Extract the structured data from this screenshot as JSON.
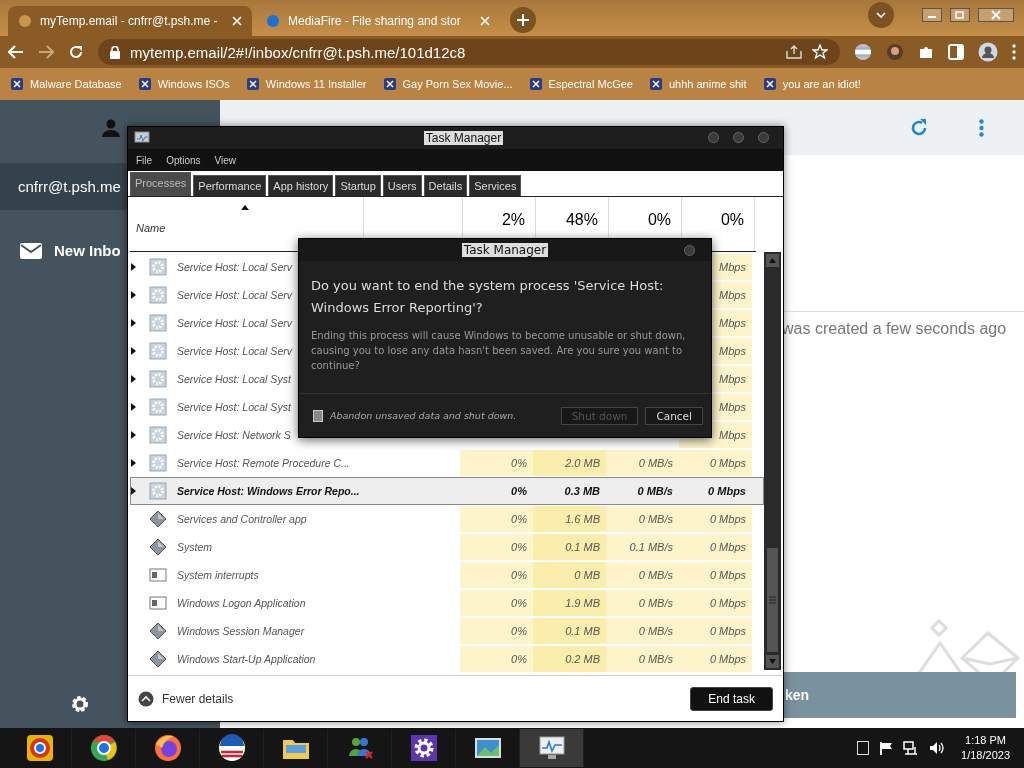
{
  "browser": {
    "tabs": [
      {
        "title": "myTemp.email - cnfrr@t.psh.me -",
        "selected": true
      },
      {
        "title": "MediaFire - File sharing and stor",
        "selected": false
      }
    ],
    "address": "mytemp.email/2#!/inbox/cnfrr@t.psh.me/101d12c8",
    "bookmarks": [
      "Malware Database",
      "Windows ISOs",
      "Windows 11 Installer",
      "Gay Porn Sex Movie...",
      "Espectral McGee",
      "uhhh anime shit",
      "you are an idiot!"
    ]
  },
  "page": {
    "account": "cnfrr@t.psh.me",
    "nav_item": "New Inbo",
    "notice": "was created a few seconds ago",
    "toast": "ken"
  },
  "task_manager": {
    "title": "Task Manager",
    "menu": [
      "File",
      "Options",
      "View"
    ],
    "tabs": [
      {
        "label": "Processes",
        "selected": true
      },
      {
        "label": "Performance",
        "selected": false
      },
      {
        "label": "App history",
        "selected": false
      },
      {
        "label": "Startup",
        "selected": false
      },
      {
        "label": "Users",
        "selected": false
      },
      {
        "label": "Details",
        "selected": false
      },
      {
        "label": "Services",
        "selected": false
      }
    ],
    "name_column": "Name",
    "totals": [
      "2%",
      "48%",
      "0%",
      "0%"
    ],
    "rows": [
      {
        "name": "Service Host: Local Serv",
        "kind": "gear",
        "expandable": true,
        "selected": false,
        "network": "Mbps"
      },
      {
        "name": "Service Host: Local Serv",
        "kind": "gear",
        "expandable": true,
        "selected": false,
        "network": "Mbps"
      },
      {
        "name": "Service Host: Local Serv",
        "kind": "gear",
        "expandable": true,
        "selected": false,
        "network": "Mbps"
      },
      {
        "name": "Service Host: Local Serv",
        "kind": "gear",
        "expandable": true,
        "selected": false,
        "network": "Mbps"
      },
      {
        "name": "Service Host: Local Syst",
        "kind": "gear",
        "expandable": true,
        "selected": false,
        "network": "Mbps"
      },
      {
        "name": "Service Host: Local Syst",
        "kind": "gear",
        "expandable": true,
        "selected": false,
        "network": "Mbps"
      },
      {
        "name": "Service Host: Network S",
        "kind": "gear",
        "expandable": true,
        "selected": false,
        "network": "Mbps"
      },
      {
        "name": "Service Host: Remote Procedure C...",
        "kind": "gear",
        "expandable": true,
        "selected": false,
        "cpu": "0%",
        "memory": "2.0 MB",
        "disk": "0 MB/s",
        "network": "0 Mbps"
      },
      {
        "name": "Service Host: Windows Error Repo...",
        "kind": "gear",
        "expandable": true,
        "selected": true,
        "cpu": "0%",
        "memory": "0.3 MB",
        "disk": "0 MB/s",
        "network": "0 Mbps"
      },
      {
        "name": "Services and Controller app",
        "kind": "diamond",
        "expandable": false,
        "selected": false,
        "cpu": "0%",
        "memory": "1.6 MB",
        "disk": "0 MB/s",
        "network": "0 Mbps"
      },
      {
        "name": "System",
        "kind": "diamond",
        "expandable": false,
        "selected": false,
        "cpu": "0%",
        "memory": "0.1 MB",
        "disk": "0.1 MB/s",
        "network": "0 Mbps"
      },
      {
        "name": "System interrupts",
        "kind": "window",
        "expandable": false,
        "selected": false,
        "cpu": "0%",
        "memory": "0 MB",
        "disk": "0 MB/s",
        "network": "0 Mbps"
      },
      {
        "name": "Windows Logon Application",
        "kind": "window",
        "expandable": false,
        "selected": false,
        "cpu": "0%",
        "memory": "1.9 MB",
        "disk": "0 MB/s",
        "network": "0 Mbps"
      },
      {
        "name": "Windows Session Manager",
        "kind": "diamond",
        "expandable": false,
        "selected": false,
        "cpu": "0%",
        "memory": "0.1 MB",
        "disk": "0 MB/s",
        "network": "0 Mbps"
      },
      {
        "name": "Windows Start-Up Application",
        "kind": "diamond",
        "expandable": false,
        "selected": false,
        "cpu": "0%",
        "memory": "0.2 MB",
        "disk": "0 MB/s",
        "network": "0 Mbps"
      }
    ],
    "fewer_details": "Fewer details",
    "end_task": "End task"
  },
  "dialog": {
    "title": "Task Manager",
    "heading": "Do you want to end the system process 'Service Host: Windows Error Reporting'?",
    "body": "Ending this process will cause Windows to become unusable or shut down, causing you to lose any data hasn't been saved. Are you sure you want to continue?",
    "checkbox": {
      "label": "Abandon unsaved data and shut down.",
      "checked": false
    },
    "buttons": [
      {
        "label": "Shut down",
        "disabled": true
      },
      {
        "label": "Cancel",
        "disabled": false
      }
    ]
  },
  "taskbar": {
    "apps": [
      {
        "kind": "chrome-alt",
        "selected": false
      },
      {
        "kind": "chrome",
        "selected": false
      },
      {
        "kind": "firefox",
        "selected": false
      },
      {
        "kind": "round-logo",
        "selected": false
      },
      {
        "kind": "folder",
        "selected": false
      },
      {
        "kind": "people",
        "selected": false
      },
      {
        "kind": "gear",
        "selected": false
      },
      {
        "kind": "picture",
        "selected": false
      },
      {
        "kind": "monitor",
        "selected": true
      }
    ],
    "time": "1:18 PM",
    "date": "1/18/2023"
  }
}
